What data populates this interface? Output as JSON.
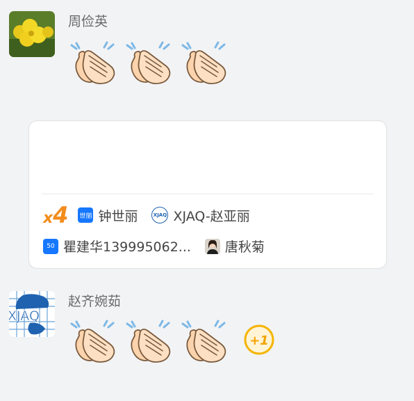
{
  "messages": [
    {
      "sender": "周俭英",
      "reactions": [
        "clap-emoji",
        "clap-emoji",
        "clap-emoji"
      ]
    },
    {
      "sender": "赵齐婉茹",
      "reactions": [
        "clap-emoji",
        "clap-emoji",
        "clap-emoji"
      ],
      "extra": "+1"
    }
  ],
  "card": {
    "count_prefix": "x",
    "count_number": "4",
    "row1": [
      {
        "avatar_text": "世丽",
        "name": "钟世丽",
        "avatar_color": "#1677ff"
      },
      {
        "avatar_text": "XJAQ",
        "name": "XJAQ-赵亚丽",
        "avatar_color": "#1e62b0"
      }
    ],
    "row2": [
      {
        "avatar_text": "50",
        "name": "瞿建华139995062...",
        "avatar_color": "#1677ff"
      },
      {
        "name": "唐秋菊"
      }
    ]
  },
  "logo_text": "XJAQ",
  "colors": {
    "background": "#f2f3f5",
    "accent_orange": "#f28c1c",
    "blue": "#1677ff"
  }
}
